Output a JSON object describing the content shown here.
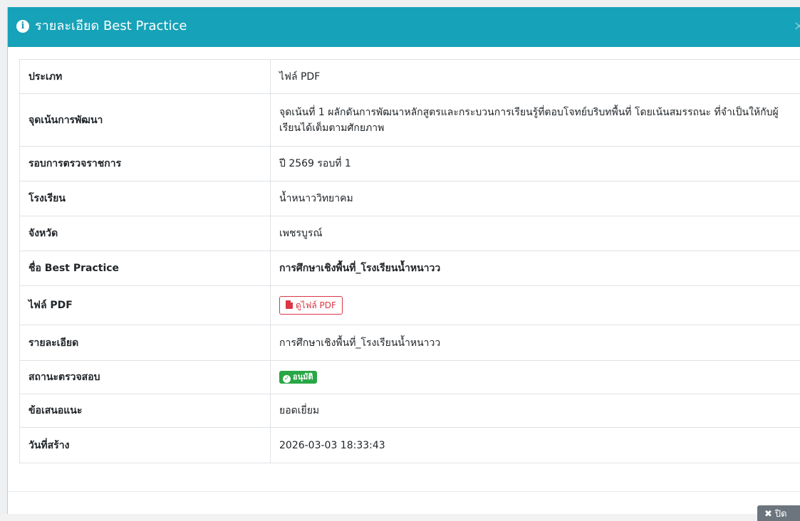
{
  "modal": {
    "title": "รายละเอียด Best Practice",
    "info_icon": "i",
    "close_icon": "×"
  },
  "details": [
    {
      "label": "ประเภท",
      "value": "ไฟล์ PDF"
    },
    {
      "label": "จุดเน้นการพัฒนา",
      "value": "จุดเน้นที่ 1 ผลักดันการพัฒนาหลักสูตรและกระบวนการเรียนรู้ที่ตอบโจทย์บริบทพื้นที่ โดยเน้นสมรรถนะ ที่จำเป็นให้กับผู้เรียนได้เต็มตามศักยภาพ"
    },
    {
      "label": "รอบการตรวจราชการ",
      "value": "ปี 2569 รอบที่ 1"
    },
    {
      "label": "โรงเรียน",
      "value": "น้ำหนาววิทยาคม"
    },
    {
      "label": "จังหวัด",
      "value": "เพชรบูรณ์"
    },
    {
      "label": "ชื่อ Best Practice",
      "value": "การศึกษาเชิงพื้นที่_โรงเรียนน้ำหนาวว"
    },
    {
      "label": "ไฟล์ PDF",
      "value": "ดูไฟล์ PDF"
    },
    {
      "label": "รายละเอียด",
      "value": "การศึกษาเชิงพื้นที่_โรงเรียนน้ำหนาวว"
    },
    {
      "label": "สถานะตรวจสอบ",
      "value": "อนุมัติ"
    },
    {
      "label": "ข้อเสนอแนะ",
      "value": "ยอดเยี่ยม"
    },
    {
      "label": "วันที่สร้าง",
      "value": "2026-03-03 18:33:43"
    }
  ],
  "footer": {
    "close_label": "ปิด",
    "close_icon": "✖"
  },
  "colors": {
    "header_bg": "#16a2b8",
    "badge_success": "#28a745",
    "pdf_button": "#dc3545",
    "close_button": "#6c757d"
  },
  "icons": {
    "header": "info-circle-icon",
    "pdf": "file-pdf-icon",
    "status": "check-circle-icon",
    "close": "times-icon"
  }
}
